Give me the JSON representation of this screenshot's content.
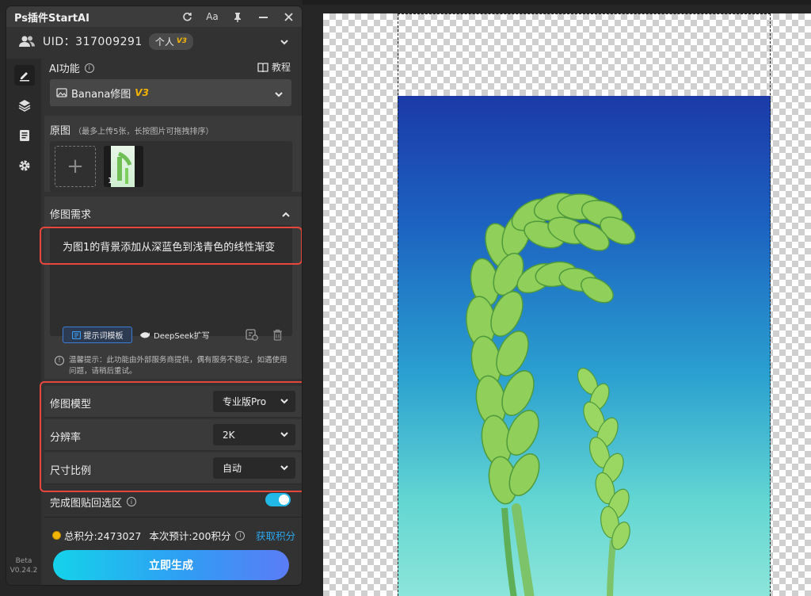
{
  "app": {
    "title": "Ps插件StartAI"
  },
  "titlebar_icons": [
    "refresh-icon",
    "font-size-icon",
    "pin-icon",
    "minimize-icon",
    "close-icon"
  ],
  "titlebar_labels": {
    "font": "Aa"
  },
  "account": {
    "uid": "UID：317009291",
    "plan": "个人",
    "plan_version": "V3"
  },
  "sidebar": {
    "items": [
      {
        "icon": "edit-icon",
        "active": true
      },
      {
        "icon": "layers-icon",
        "active": false
      },
      {
        "icon": "document-icon",
        "active": false
      },
      {
        "icon": "settings-icon",
        "active": false
      }
    ],
    "version_line1": "Beta",
    "version_line2": "V0.24.2"
  },
  "ai": {
    "heading": "AI功能",
    "tutorial": "教程",
    "model_select": "Banana修图",
    "model_version": "V3"
  },
  "original": {
    "title": "原图",
    "hint": "（最多上传5张，长按图片可拖拽排序）",
    "add_symbol": "+",
    "thumb_index": "1"
  },
  "request": {
    "title": "修图需求",
    "text": "为图1的背景添加从深蓝色到浅青色的线性渐变",
    "template_button": "提示词模板",
    "deepseek_button": "DeepSeek扩写"
  },
  "tip": {
    "text": "温馨提示：此功能由外部服务商提供，偶有服务不稳定，如遇使用问题，请稍后重试。"
  },
  "options": [
    {
      "label": "修图模型",
      "value": "专业版Pro"
    },
    {
      "label": "分辨率",
      "value": "2K"
    },
    {
      "label": "尺寸比例",
      "value": "自动"
    }
  ],
  "paste_back": {
    "label": "完成图贴回选区",
    "enabled": true
  },
  "footer": {
    "points": "总积分:2473027",
    "estimate": "本次预计:200积分",
    "get_points": "获取积分",
    "generate": "立即生成"
  },
  "colors": {
    "accent_blue": "#2aa7f0",
    "highlight_red": "#e5473b",
    "version_gold": "#f5b400"
  }
}
